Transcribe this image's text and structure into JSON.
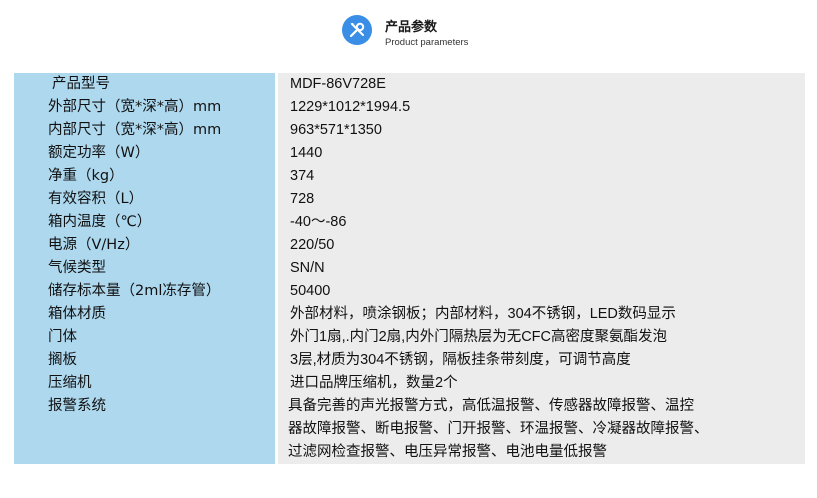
{
  "header": {
    "title_cn": "产品参数",
    "title_en": "Product parameters",
    "icon": "wrench-screwdriver-icon",
    "accent": "#3a8ee6"
  },
  "table": {
    "label_bg": "#add8ee",
    "value_bg": "#ececec",
    "rows": [
      {
        "label": "产品型号",
        "value": "MDF-86V728E"
      },
      {
        "label": "外部尺寸（宽*深*高）mm",
        "value": "1229*1012*1994.5"
      },
      {
        "label": "内部尺寸（宽*深*高）mm",
        "value": "963*571*1350"
      },
      {
        "label": "额定功率（W）",
        "value": "1440"
      },
      {
        "label": "净重（kg）",
        "value": "374"
      },
      {
        "label": "有效容积（L）",
        "value": " 728"
      },
      {
        "label": "箱内温度（℃）",
        "value": "-40～-86"
      },
      {
        "label": "电源（V/Hz）",
        "value": " 220/50"
      },
      {
        "label": "气候类型",
        "value": "SN/N"
      },
      {
        "label": "储存标本量（2ml冻存管）",
        "value": "50400"
      },
      {
        "label": "箱体材质",
        "value": " 外部材料，喷涂钢板；内部材料，304不锈钢，LED数码显示"
      },
      {
        "label": "门体",
        "value": " 外门1扇,.内门2扇,内外门隔热层为无CFC高密度聚氨酯发泡"
      },
      {
        "label": "搁板",
        "value": " 3层,材质为304不锈钢，隔板挂条带刻度，可调节高度"
      },
      {
        "label": "压缩机",
        "value": "进口品牌压缩机，数量2个"
      }
    ],
    "alarm": {
      "label": "报警系统",
      "lines": [
        "具备完善的声光报警方式，高低温报警、传感器故障报警、温控",
        "器故障报警、断电报警、门开报警、环温报警、冷凝器故障报警、",
        "过滤网检查报警、电压异常报警、电池电量低报警"
      ]
    }
  }
}
